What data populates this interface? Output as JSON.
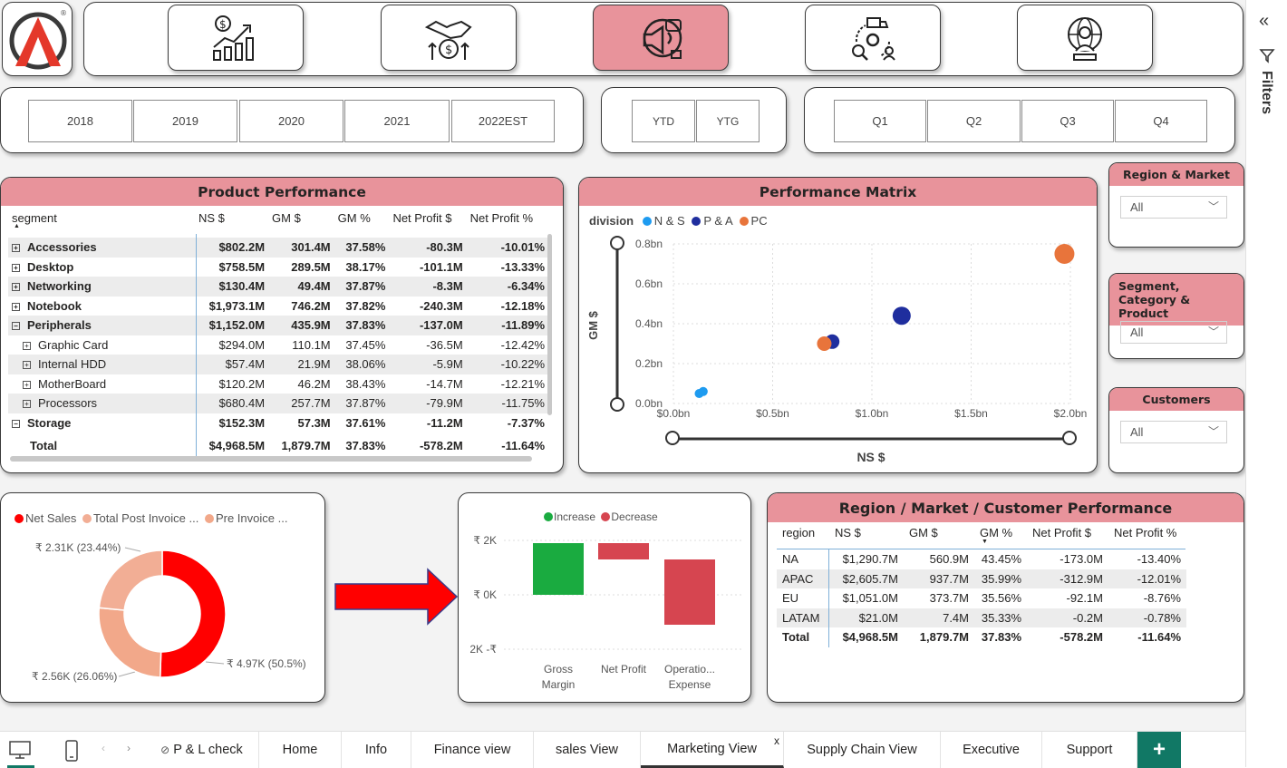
{
  "nav": {
    "active": "marketing"
  },
  "years": [
    "2018",
    "2019",
    "2020",
    "2021",
    "2022EST"
  ],
  "period": [
    "YTD",
    "YTG"
  ],
  "quarters": [
    "Q1",
    "Q2",
    "Q3",
    "Q4"
  ],
  "product_performance": {
    "title": "Product Performance",
    "columns": [
      "segment",
      "NS $",
      "GM $",
      "GM %",
      "Net Profit $",
      "Net Profit %"
    ],
    "rows": [
      {
        "name": "Accessories",
        "ns": "$802.2M",
        "gm": "301.4M",
        "gmp": "37.58%",
        "np": "-80.3M",
        "npp": "-10.01%",
        "level": 0,
        "expanded": false
      },
      {
        "name": "Desktop",
        "ns": "$758.5M",
        "gm": "289.5M",
        "gmp": "38.17%",
        "np": "-101.1M",
        "npp": "-13.33%",
        "level": 0,
        "expanded": false
      },
      {
        "name": "Networking",
        "ns": "$130.4M",
        "gm": "49.4M",
        "gmp": "37.87%",
        "np": "-8.3M",
        "npp": "-6.34%",
        "level": 0,
        "expanded": false
      },
      {
        "name": "Notebook",
        "ns": "$1,973.1M",
        "gm": "746.2M",
        "gmp": "37.82%",
        "np": "-240.3M",
        "npp": "-12.18%",
        "level": 0,
        "expanded": false
      },
      {
        "name": "Peripherals",
        "ns": "$1,152.0M",
        "gm": "435.9M",
        "gmp": "37.83%",
        "np": "-137.0M",
        "npp": "-11.89%",
        "level": 0,
        "expanded": true
      },
      {
        "name": "Graphic Card",
        "ns": "$294.0M",
        "gm": "110.1M",
        "gmp": "37.45%",
        "np": "-36.5M",
        "npp": "-12.42%",
        "level": 1,
        "expanded": false
      },
      {
        "name": "Internal HDD",
        "ns": "$57.4M",
        "gm": "21.9M",
        "gmp": "38.06%",
        "np": "-5.9M",
        "npp": "-10.22%",
        "level": 1,
        "expanded": false
      },
      {
        "name": "MotherBoard",
        "ns": "$120.2M",
        "gm": "46.2M",
        "gmp": "38.43%",
        "np": "-14.7M",
        "npp": "-12.21%",
        "level": 1,
        "expanded": false
      },
      {
        "name": "Processors",
        "ns": "$680.4M",
        "gm": "257.7M",
        "gmp": "37.87%",
        "np": "-79.9M",
        "npp": "-11.75%",
        "level": 1,
        "expanded": false
      },
      {
        "name": "Storage",
        "ns": "$152.3M",
        "gm": "57.3M",
        "gmp": "37.61%",
        "np": "-11.2M",
        "npp": "-7.37%",
        "level": 0,
        "expanded": true
      }
    ],
    "total": {
      "name": "Total",
      "ns": "$4,968.5M",
      "gm": "1,879.7M",
      "gmp": "37.83%",
      "np": "-578.2M",
      "npp": "-11.64%"
    }
  },
  "performance_matrix": {
    "title": "Performance Matrix",
    "legend_title": "division",
    "divisions": [
      {
        "name": "N & S",
        "color": "#1e9bf0"
      },
      {
        "name": "P & A",
        "color": "#1f2e9e"
      },
      {
        "name": "PC",
        "color": "#e8743b"
      }
    ],
    "y_ticks": [
      "0.8bn",
      "0.6bn",
      "0.4bn",
      "0.2bn",
      "0.0bn"
    ],
    "x_ticks": [
      "$0.0bn",
      "$0.5bn",
      "$1.0bn",
      "$1.5bn",
      "$2.0bn"
    ],
    "xlabel": "NS $",
    "ylabel": "GM $"
  },
  "region_slicer": {
    "title": "Region & Market",
    "value": "All"
  },
  "segment_slicer": {
    "title": "Segment, Category & Product",
    "value": "All"
  },
  "customer_slicer": {
    "title": "Customers",
    "value": "All"
  },
  "donut": {
    "legend": [
      "Net Sales",
      "Total Post Invoice ...",
      "Pre Invoice ..."
    ],
    "labels": [
      "₹ 2.31K (23.44%)",
      "₹ 2.56K (26.06%)",
      "₹ 4.97K (50.5%)"
    ]
  },
  "waterfall": {
    "legend": [
      "Increase",
      "Decrease"
    ],
    "y_ticks": [
      "₹ 2K",
      "₹ 0K",
      "2K -₹"
    ],
    "categories": [
      "Gross Margin",
      "Net Profit",
      "Operatio... Expense"
    ]
  },
  "region_perf": {
    "title": "Region / Market / Customer Performance",
    "columns": [
      "region",
      "NS $",
      "GM $",
      "GM %",
      "Net Profit $",
      "Net Profit %"
    ],
    "rows": [
      {
        "name": "NA",
        "ns": "$1,290.7M",
        "gm": "560.9M",
        "gmp": "43.45%",
        "np": "-173.0M",
        "npp": "-13.40%"
      },
      {
        "name": "APAC",
        "ns": "$2,605.7M",
        "gm": "937.7M",
        "gmp": "35.99%",
        "np": "-312.9M",
        "npp": "-12.01%"
      },
      {
        "name": "EU",
        "ns": "$1,051.0M",
        "gm": "373.7M",
        "gmp": "35.56%",
        "np": "-92.1M",
        "npp": "-8.76%"
      },
      {
        "name": "LATAM",
        "ns": "$21.0M",
        "gm": "7.4M",
        "gmp": "35.33%",
        "np": "-0.2M",
        "npp": "-0.78%"
      }
    ],
    "total": {
      "name": "Total",
      "ns": "$4,968.5M",
      "gm": "1,879.7M",
      "gmp": "37.83%",
      "np": "-578.2M",
      "npp": "-11.64%"
    }
  },
  "tabs": [
    "P & L check",
    "Home",
    "Info",
    "Finance view",
    "sales View",
    "Marketing View",
    "Supply Chain View",
    "Executive",
    "Support"
  ],
  "active_tab": "Marketing View",
  "tab_close": "x",
  "add_tab": "+",
  "filters_label": "Filters",
  "chart_data": [
    {
      "type": "scatter",
      "title": "Performance Matrix",
      "xlabel": "NS $",
      "ylabel": "GM $",
      "xlim": [
        0,
        2.0
      ],
      "ylim": [
        0,
        0.8
      ],
      "series": [
        {
          "name": "N & S",
          "points": [
            [
              0.13,
              0.05
            ],
            [
              0.15,
              0.06
            ]
          ]
        },
        {
          "name": "P & A",
          "points": [
            [
              0.8,
              0.31
            ],
            [
              1.15,
              0.44
            ]
          ]
        },
        {
          "name": "PC",
          "points": [
            [
              0.76,
              0.3
            ],
            [
              1.97,
              0.75
            ]
          ]
        }
      ]
    },
    {
      "type": "pie",
      "donut": true,
      "series": [
        {
          "name": "Net Sales",
          "value": 4.97,
          "percent": 50.5,
          "color": "#ff0000"
        },
        {
          "name": "Pre Invoice ...",
          "value": 2.56,
          "percent": 26.06,
          "color": "#f2a88a"
        },
        {
          "name": "Total Post Invoice ...",
          "value": 2.31,
          "percent": 23.44,
          "color": "#f2ae95"
        }
      ]
    },
    {
      "type": "bar",
      "subtype": "waterfall",
      "categories": [
        "Gross Margin",
        "Net Profit",
        "Operatio... Expense"
      ],
      "series": [
        {
          "name": "Increase",
          "color": "#1aab40",
          "bars": [
            {
              "category": "Gross Margin",
              "start": 0,
              "end": 1.9
            }
          ]
        },
        {
          "name": "Decrease",
          "color": "#d64550",
          "bars": [
            {
              "category": "Net Profit",
              "start": 1.9,
              "end": 1.3
            },
            {
              "category": "Operatio... Expense",
              "start": 1.3,
              "end": -1.1
            }
          ]
        }
      ],
      "ylim": [
        -2,
        2
      ]
    }
  ]
}
